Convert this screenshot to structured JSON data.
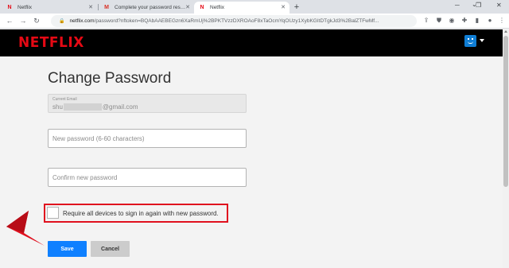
{
  "browser": {
    "tabs": [
      {
        "title": "Netflix",
        "favicon": "netflix-n-icon",
        "active": false
      },
      {
        "title": "Complete your password reset r...",
        "favicon": "gmail-icon",
        "active": false
      },
      {
        "title": "Netflix",
        "favicon": "netflix-n-icon",
        "active": true
      }
    ],
    "new_tab_symbol": "+",
    "url_host": "netflix.com",
    "url_rest": "/password?nftoken=BQAbAAEBEGzn6XaRmUj%2BPKTVzzDXROAoF8xTaOcmYqOUzy1XybKGItDTgkJd3%2BalZTFwMf..."
  },
  "header": {
    "logo_text": "NETFLIX",
    "brand_color": "#e50914",
    "avatar_color": "#0f7dd4"
  },
  "form": {
    "title": "Change Password",
    "current_email": {
      "label": "Current Email",
      "value_prefix": "shu",
      "value_suffix": "@gmail.com"
    },
    "new_password": {
      "placeholder": "New password (6-60 characters)",
      "value": ""
    },
    "confirm_password": {
      "placeholder": "Confirm new password",
      "value": ""
    },
    "require_signin": {
      "label": "Require all devices to sign in again with new password.",
      "checked": false
    },
    "save_label": "Save",
    "cancel_label": "Cancel",
    "save_color": "#0f80ff",
    "highlight_color": "#e0101e"
  }
}
